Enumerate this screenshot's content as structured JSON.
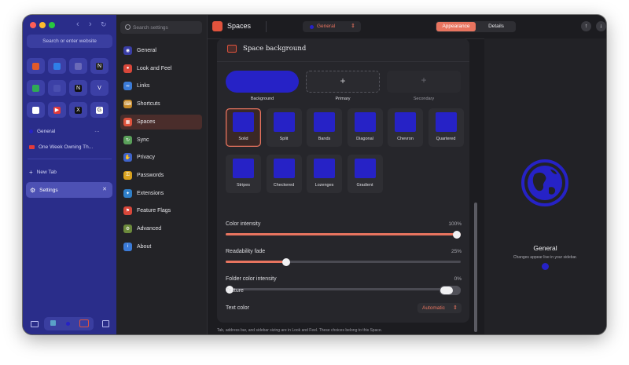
{
  "browser_sidebar": {
    "url_placeholder": "Search or enter website",
    "space_name": "General",
    "more_label": "···",
    "tab_title": "One Week Owning Th...",
    "new_tab_label": "New Tab",
    "settings_tab_label": "Settings",
    "close_glyph": "✕",
    "pinned_icons": [
      "app-icon-orange",
      "app-icon-blue",
      "app-icon-avatar",
      "app-icon-notion",
      "app-icon-green",
      "app-icon-grid",
      "app-icon-notion-2",
      "app-icon-v",
      "app-icon-openai",
      "app-icon-youtube",
      "app-icon-x",
      "app-icon-google"
    ],
    "pinned_glyphs": [
      "",
      "",
      "",
      "N",
      "",
      "",
      "N",
      "V",
      "",
      "▶",
      "X",
      "G"
    ]
  },
  "settings_nav": {
    "search_placeholder": "Search settings",
    "items": [
      {
        "label": "General",
        "icon": "globe-icon",
        "color": "#3a3ea6"
      },
      {
        "label": "Look and Feel",
        "icon": "palette-icon",
        "color": "#d8473a"
      },
      {
        "label": "Links",
        "icon": "link-icon",
        "color": "#3b7bd8"
      },
      {
        "label": "Shortcuts",
        "icon": "keyboard-icon",
        "color": "#c68a2a"
      },
      {
        "label": "Spaces",
        "icon": "spaces-icon",
        "color": "#e0533d"
      },
      {
        "label": "Sync",
        "icon": "sync-icon",
        "color": "#5aa05a"
      },
      {
        "label": "Privacy",
        "icon": "hand-icon",
        "color": "#3f63c9"
      },
      {
        "label": "Passwords",
        "icon": "key-icon",
        "color": "#d9a21e"
      },
      {
        "label": "Extensions",
        "icon": "puzzle-icon",
        "color": "#2f7fc8"
      },
      {
        "label": "Feature Flags",
        "icon": "flag-icon",
        "color": "#d8473a"
      },
      {
        "label": "Advanced",
        "icon": "gear-icon",
        "color": "#6c8a3c"
      },
      {
        "label": "About",
        "icon": "info-icon",
        "color": "#3b7bd8"
      }
    ],
    "active_index": 4
  },
  "header": {
    "title": "Spaces",
    "space_selector": "General",
    "tabs": [
      "Appearance",
      "Details"
    ],
    "active_tab": 0
  },
  "space_background": {
    "title": "Space background",
    "slots": [
      {
        "label": "Background"
      },
      {
        "label": "Primary"
      },
      {
        "label": "Secondary"
      }
    ],
    "add_glyph": "+",
    "patterns": [
      "Solid",
      "Split",
      "Bands",
      "Diagonal",
      "Chevron",
      "Quartered",
      "Stripes",
      "Checkered",
      "Lozenges",
      "Gradient"
    ],
    "selected_pattern": 0
  },
  "sliders": [
    {
      "label": "Color intensity",
      "value_text": "100%",
      "value": 1.0
    },
    {
      "label": "Readability fade",
      "value_text": "25%",
      "value": 0.25
    },
    {
      "label": "Folder color intensity",
      "value_text": "0%",
      "value": 0.0
    }
  ],
  "texture": {
    "label": "Texture",
    "on": false
  },
  "text_color": {
    "label": "Text color",
    "value": "Automatic"
  },
  "footer_note": "Tab, address bar, and sidebar sizing are in Look and Feel. These choices belong to this Space.",
  "preview": {
    "title": "General",
    "subtitle": "Changes appear live in your sidebar."
  },
  "colors": {
    "accent": "#e8745f",
    "space_blue": "#2622c6",
    "sidebar": "#2a2d8a"
  }
}
